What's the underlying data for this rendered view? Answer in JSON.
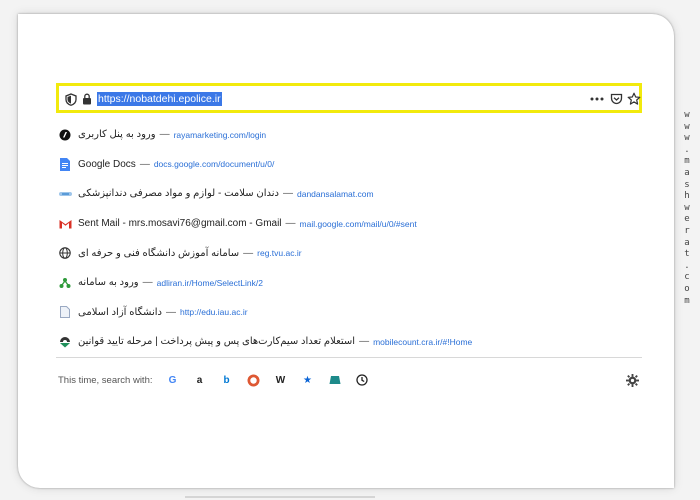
{
  "address_bar": {
    "url": "https://nobatdehi.epolice.ir"
  },
  "suggestions": [
    {
      "title": "ورود به پنل کاربری",
      "sep": "—",
      "url": "rayamarketing.com/login",
      "icon": "black-circle-logo-icon",
      "rtl": true
    },
    {
      "title": "Google Docs",
      "sep": "—",
      "url": "docs.google.com/document/u/0/",
      "icon": "google-docs-icon",
      "rtl": false
    },
    {
      "title": "دندان سلامت - لوازم و مواد مصرفی دندانپزشکی",
      "sep": "—",
      "url": "dandansalamat.com",
      "icon": "dandan-logo-icon",
      "rtl": true
    },
    {
      "title": "Sent Mail - mrs.mosavi76@gmail.com - Gmail",
      "sep": "—",
      "url": "mail.google.com/mail/u/0/#sent",
      "icon": "gmail-icon",
      "rtl": false
    },
    {
      "title": "سامانه آموزش دانشگاه فنی و حرفه ای",
      "sep": "—",
      "url": "reg.tvu.ac.ir",
      "icon": "globe-icon",
      "rtl": true
    },
    {
      "title": "ورود به سامانه",
      "sep": "—",
      "url": "adliran.ir/Home/SelectLink/2",
      "icon": "green-tree-logo-icon",
      "rtl": true
    },
    {
      "title": "دانشگاه آزاد اسلامی",
      "sep": "—",
      "url": "http://edu.iau.ac.ir",
      "icon": "page-icon",
      "rtl": true
    },
    {
      "title": "استعلام تعداد سیم‌کارت‌های پس و پیش پرداخت | مرحله تایید قوانین",
      "sep": "—",
      "url": "mobilecount.cra.ir/#!Home",
      "icon": "cra-logo-icon",
      "rtl": true
    }
  ],
  "search_bar": {
    "label": "This time, search with:",
    "engines": [
      {
        "name": "google",
        "glyph": "G",
        "color": "#4285f4"
      },
      {
        "name": "amazon",
        "glyph": "a",
        "color": "#222222"
      },
      {
        "name": "bing",
        "glyph": "b",
        "color": "#0078d4"
      },
      {
        "name": "duckduckgo",
        "glyph": "D",
        "color": "#de5833"
      },
      {
        "name": "wikipedia",
        "glyph": "W",
        "color": "#222222"
      },
      {
        "name": "bookmarks",
        "glyph": "★",
        "color": "#0a64d6"
      },
      {
        "name": "tabs",
        "glyph": "",
        "color": "#1d8a8a"
      },
      {
        "name": "history",
        "glyph": "",
        "color": "#222222"
      }
    ]
  },
  "watermark": "www.mashwerat.com",
  "colors": {
    "highlight": "#f2ea0d",
    "selection": "#3b78e7",
    "link": "#2a6fd6"
  }
}
